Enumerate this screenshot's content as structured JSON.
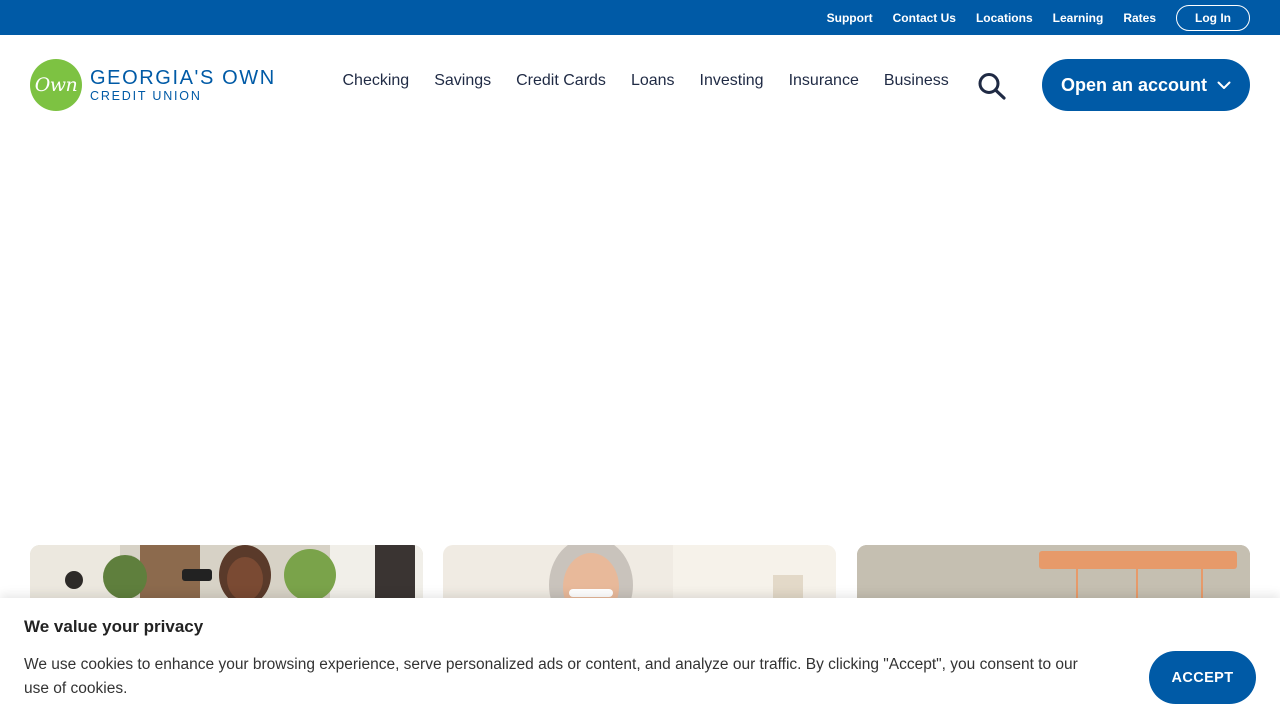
{
  "utility_nav": {
    "links": [
      "Support",
      "Contact Us",
      "Locations",
      "Learning",
      "Rates"
    ],
    "login_label": "Log In"
  },
  "logo": {
    "badge_text": "Own",
    "line1": "GEORGIA'S OWN",
    "line2": "CREDIT UNION"
  },
  "primary_nav": {
    "items": [
      "Checking",
      "Savings",
      "Credit Cards",
      "Loans",
      "Investing",
      "Insurance",
      "Business"
    ],
    "search_icon": "search-icon",
    "open_account_label": "Open an account",
    "open_account_icon": "chevron-down-icon"
  },
  "cookie_banner": {
    "title": "We value your privacy",
    "body": "We use cookies to enhance your browsing experience, serve personalized ads or content, and analyze our traffic. By clicking \"Accept\", you consent to our use of cookies.",
    "accept_label": "ACCEPT"
  },
  "colors": {
    "brand_blue": "#005aa6",
    "logo_green": "#7dc242",
    "nav_text": "#1f2a44"
  }
}
